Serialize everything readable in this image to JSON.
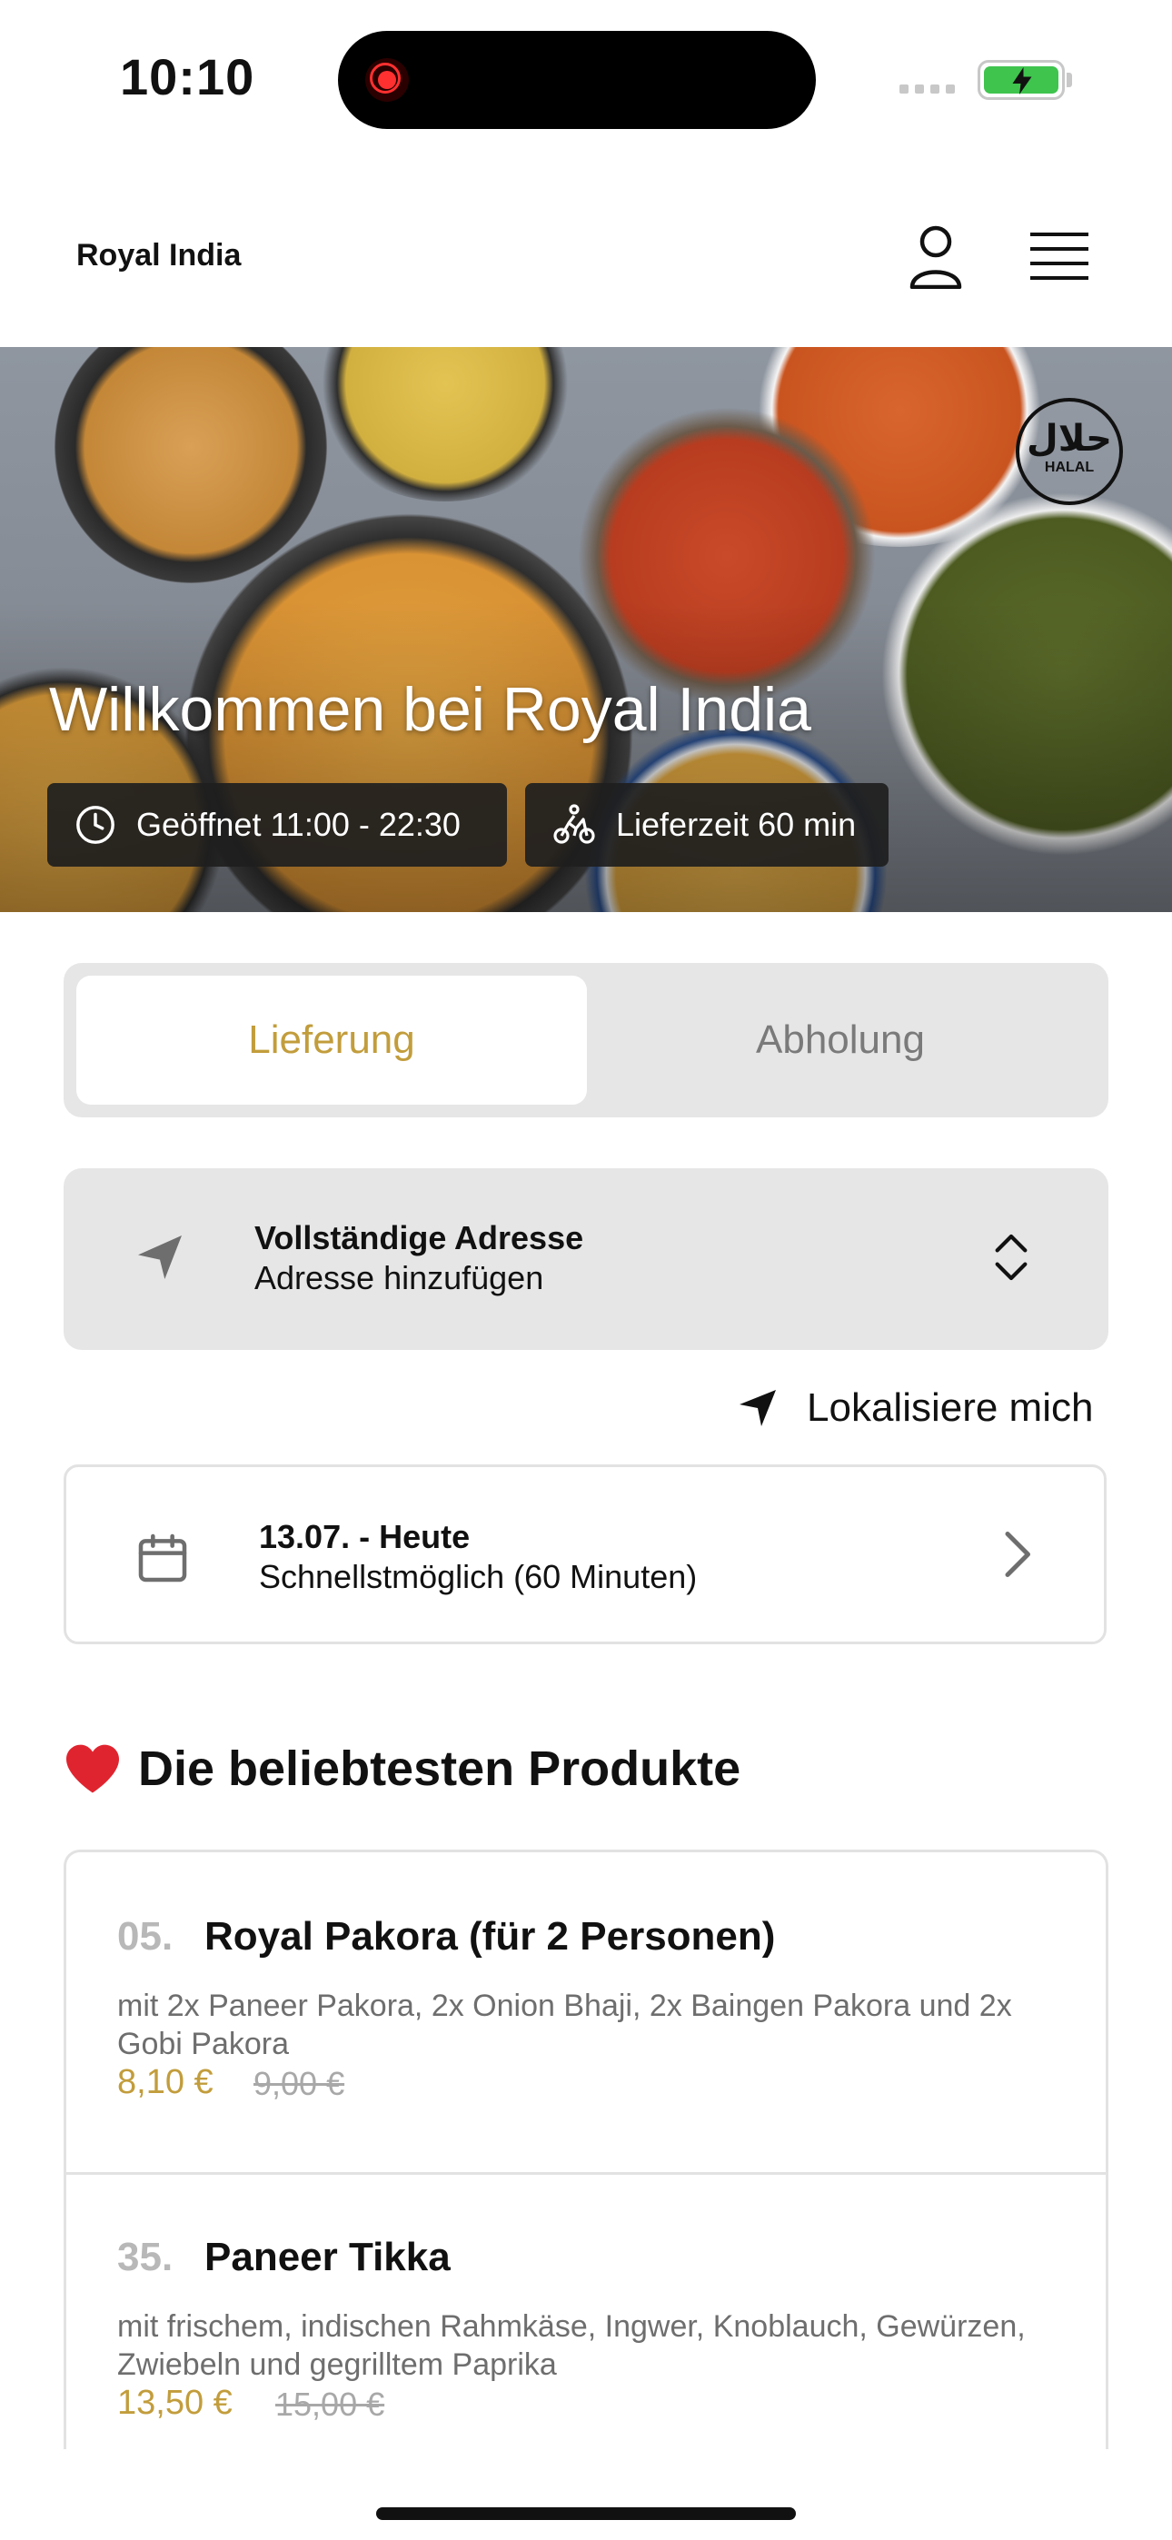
{
  "status_bar": {
    "time": "10:10"
  },
  "header": {
    "brand": "Royal India",
    "profile_icon": "person-icon",
    "menu_icon": "hamburger-menu-icon"
  },
  "hero": {
    "title": "Willkommen bei Royal India",
    "badge_text": "HALAL",
    "badge_arabic": "حلال",
    "open_label": "Geöffnet 11:00 - 22:30",
    "delivery_time_label": "Lieferzeit 60 min"
  },
  "tabs": {
    "active": "Lieferung",
    "inactive": "Abholung"
  },
  "address": {
    "title": "Vollständige Adresse",
    "subtitle": "Adresse hinzufügen"
  },
  "locate": {
    "label": "Lokalisiere mich"
  },
  "schedule": {
    "title": "13.07. - Heute",
    "subtitle": "Schnellstmöglich (60 Minuten)"
  },
  "popular": {
    "title": "Die beliebtesten Produkte",
    "products": [
      {
        "number": "05.",
        "name": "Royal Pakora (für 2 Personen)",
        "description": "mit 2x Paneer Pakora, 2x Onion Bhaji, 2x Baingen Pakora und 2x Gobi Pakora",
        "price": "8,10 €",
        "old_price": "9,00 €"
      },
      {
        "number": "35.",
        "name": "Paneer Tikka",
        "description": "mit frischem, indischen Rahmkäse, Ingwer, Knoblauch, Gewürzen, Zwiebeln und gegrilltem Paprika",
        "price": "13,50 €",
        "old_price": "15,00 €"
      }
    ]
  },
  "colors": {
    "accent": "#c29d3c",
    "panel": "#e6e6e6",
    "battery": "#3fc44e"
  }
}
